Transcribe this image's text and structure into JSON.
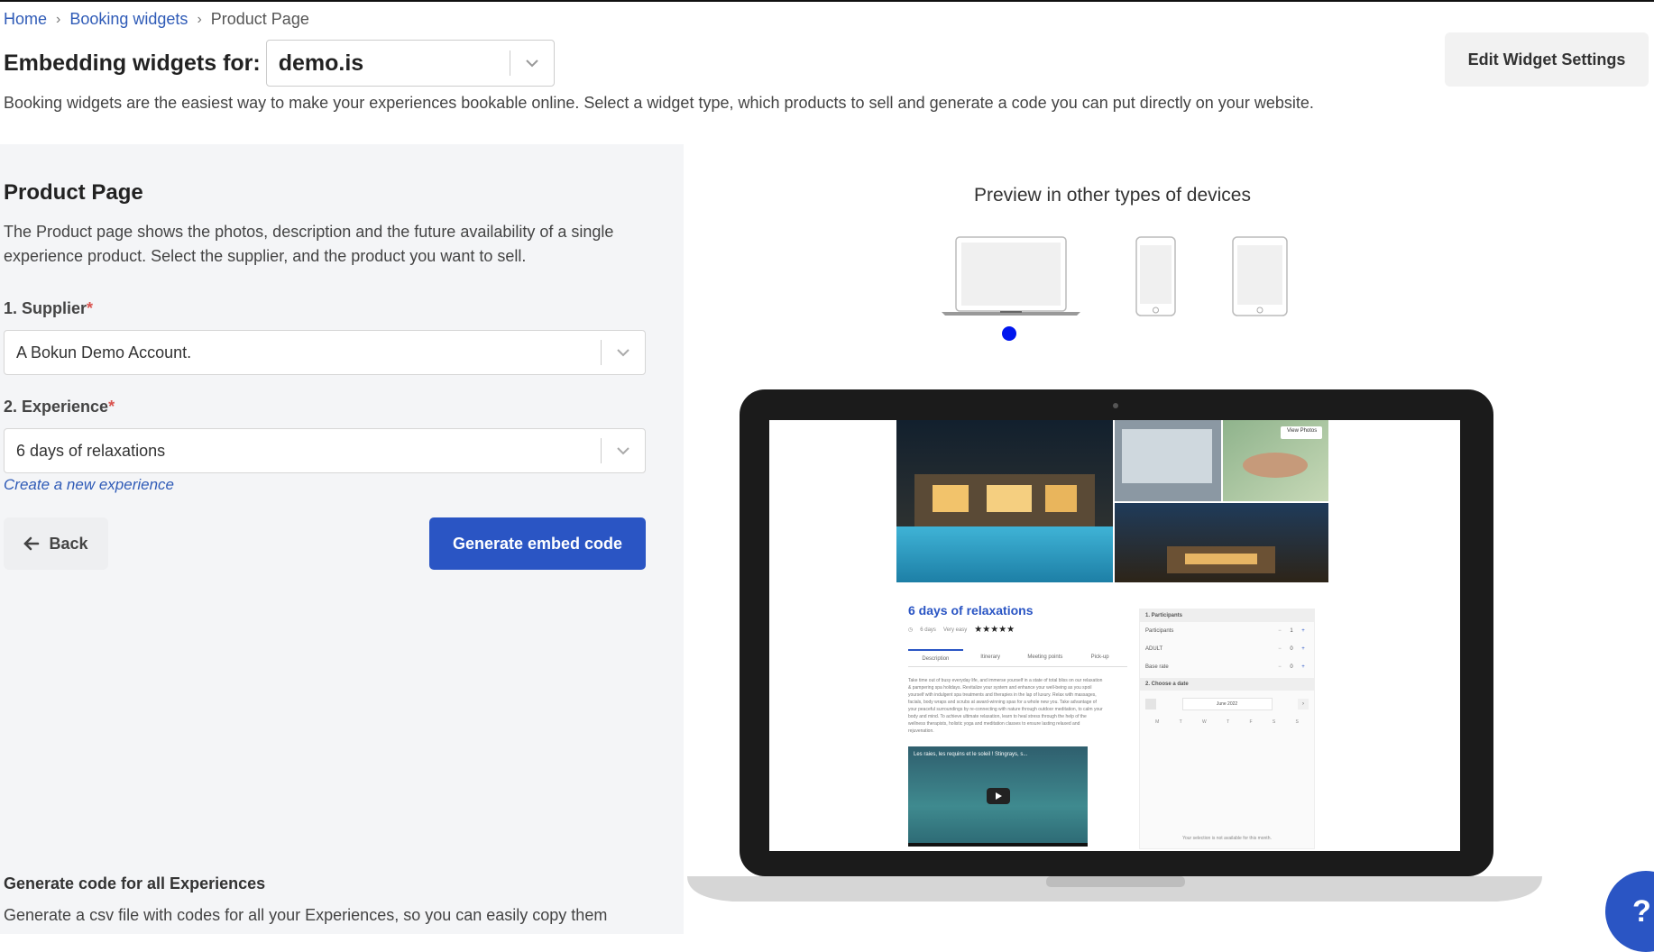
{
  "breadcrumb": {
    "home": "Home",
    "widgets": "Booking widgets",
    "current": "Product Page",
    "separator": "›"
  },
  "header": {
    "embed_label": "Embedding widgets for:",
    "domain_value": "demo.is",
    "edit_button": "Edit Widget Settings",
    "intro": "Booking widgets are the easiest way to make your experiences bookable online. Select a widget type, which products to sell and generate a code you can put directly on your website."
  },
  "form": {
    "title": "Product Page",
    "description": "The Product page shows the photos, description and the future availability of a single experience product. Select the supplier, and the product you want to sell.",
    "supplier_label": "1. Supplier",
    "supplier_value": "A Bokun Demo Account.",
    "experience_label": "2. Experience",
    "experience_value": "6 days of relaxations",
    "required_mark": "*",
    "create_link": "Create a new experience",
    "back_button": "Back",
    "generate_button": "Generate embed code"
  },
  "bulk": {
    "title": "Generate code for all Experiences",
    "description": "Generate a csv file with codes for all your Experiences, so you can easily copy them"
  },
  "preview": {
    "title": "Preview in other types of devices",
    "selected_device": "laptop",
    "product_title": "6 days of relaxations",
    "meta_duration": "6 days",
    "meta_difficulty": "Very easy",
    "stars": "★★★★★",
    "view_photos": "View Photos",
    "tabs": [
      "Description",
      "Itinerary",
      "Meeting points",
      "Pick-up"
    ],
    "body_lines": [
      "Take time out of busy everyday life, and immerse yourself in a state of total bliss on our relaxation",
      "& pampering spa holidays. Revitalize your system and enhance your well-being as you spoil",
      "yourself with indulgent spa treatments and therapies in the lap of luxury. Relax with massages,",
      "facials, body wraps and scrubs at award-winning spas for a whole new you. Take advantage of",
      "your peaceful surroundings by re-connecting with nature through outdoor meditation, to calm your",
      "body and mind. To achieve ultimate relaxation, learn to heal stress through the help of the",
      "wellness therapists, holistic yoga and meditation classes to ensure lasting relaxed and",
      "rejuvenation."
    ],
    "video_title": "Les raies, les requins et le soleil ! Stingrays, s...",
    "participants_label": "1. Participants",
    "participants_row": "Participants",
    "participants_value": "1",
    "adult_row": "ADULT",
    "adult_value": "0",
    "base_row": "Base rate",
    "base_value": "0",
    "minus": "−",
    "plus": "+",
    "date_label": "2. Choose a date",
    "month": "June 2022",
    "weekdays": [
      "M",
      "T",
      "W",
      "T",
      "F",
      "S",
      "S"
    ],
    "unavailable": "Your selection is not available for this month."
  },
  "help": {
    "label": "?"
  },
  "colors": {
    "accent": "#2a55c4",
    "link": "#2f5bb7",
    "required": "#d9534f",
    "indicator": "#0016ee"
  }
}
